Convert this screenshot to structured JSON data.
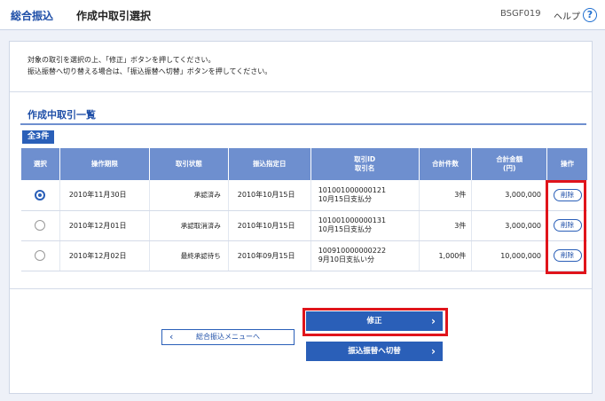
{
  "header": {
    "section": "総合振込",
    "title": "作成中取引選択",
    "screen_id": "BSGF019",
    "help_label": "ヘルプ",
    "help_icon": "?"
  },
  "instructions": {
    "line1": "対象の取引を選択の上、「修正」ボタンを押してください。",
    "line2": "振込振替へ切り替える場合は、「振込振替へ切替」ボタンを押してください。"
  },
  "list": {
    "title": "作成中取引一覧",
    "count_label": "全3件",
    "headers": {
      "select": "選択",
      "date": "操作期限",
      "status": "取引状態",
      "transfer_date": "振込指定日",
      "id_line1": "取引ID",
      "id_line2": "取引名",
      "count": "合計件数",
      "amount_line1": "合計金額",
      "amount_line2": "(円)",
      "op": "操作"
    },
    "rows": [
      {
        "date": "2010年11月30日",
        "status": "承認済み",
        "transfer_date": "2010年10月15日",
        "id": "101001000000121",
        "name": "10月15日支払分",
        "count": "3件",
        "amount": "3,000,000",
        "delete_label": "削除"
      },
      {
        "date": "2010年12月01日",
        "status": "承認取消済み",
        "transfer_date": "2010年10月15日",
        "id": "101001000000131",
        "name": "10月15日支払分",
        "count": "3件",
        "amount": "3,000,000",
        "delete_label": "削除"
      },
      {
        "date": "2010年12月02日",
        "status": "最終承認待ち",
        "transfer_date": "2010年09月15日",
        "id": "100910000000222",
        "name": "9月10日支払い分",
        "count": "1,000件",
        "amount": "10,000,000",
        "delete_label": "削除"
      }
    ]
  },
  "buttons": {
    "back_label": "総合振込メニューへ",
    "modify_label": "修正",
    "switch_label": "振込振替へ切替"
  },
  "colors": {
    "accent": "#2a5fb8",
    "highlight": "#e0141b",
    "table_header": "#6e8fcf"
  }
}
